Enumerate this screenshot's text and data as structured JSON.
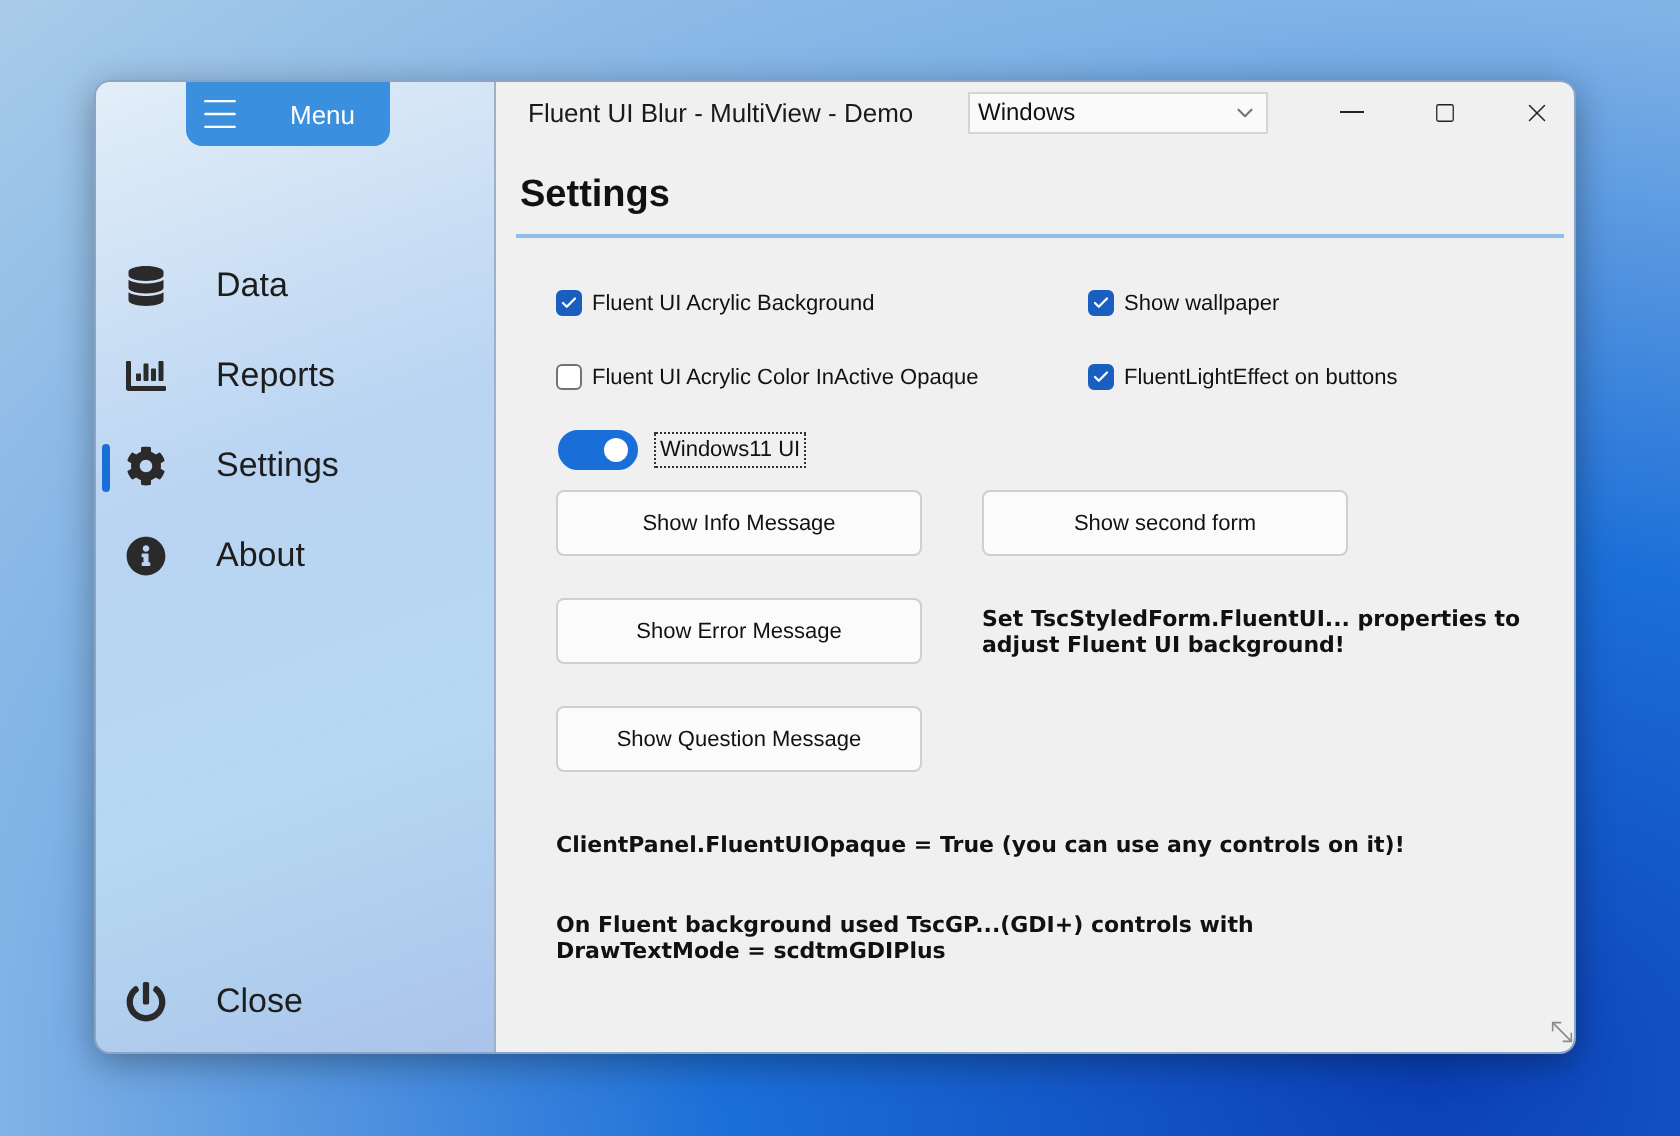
{
  "window": {
    "title": "Fluent UI Blur - MultiView - Demo"
  },
  "menu_button": {
    "label": "Menu"
  },
  "style_select": {
    "value": "Windows"
  },
  "sidebar": {
    "items": [
      {
        "label": "Data",
        "kind": "data",
        "selected": false
      },
      {
        "label": "Reports",
        "kind": "reports",
        "selected": false
      },
      {
        "label": "Settings",
        "kind": "settings",
        "selected": true
      },
      {
        "label": "About",
        "kind": "about",
        "selected": false
      }
    ],
    "close": {
      "label": "Close"
    }
  },
  "page": {
    "heading": "Settings",
    "checkboxes": [
      {
        "label": "Fluent UI Acrylic Background",
        "checked": true
      },
      {
        "label": "Show wallpaper",
        "checked": true
      },
      {
        "label": "Fluent UI Acrylic Color InActive Opaque",
        "checked": false
      },
      {
        "label": "FluentLightEffect on buttons",
        "checked": true
      }
    ],
    "toggle": {
      "label": "Windows11 UI",
      "on": true
    },
    "buttons": [
      "Show Info Message",
      "Show second form",
      "Show Error Message",
      "Show Question Message"
    ],
    "side_note": "Set TscStyledForm.FluentUI... properties to adjust Fluent UI background!",
    "notes": [
      "ClientPanel.FluentUIOpaque = True (you can use any controls on it)!",
      "On Fluent background used TscGP...(GDI+) controls with DrawTextMode = scdtmGDIPlus"
    ]
  }
}
